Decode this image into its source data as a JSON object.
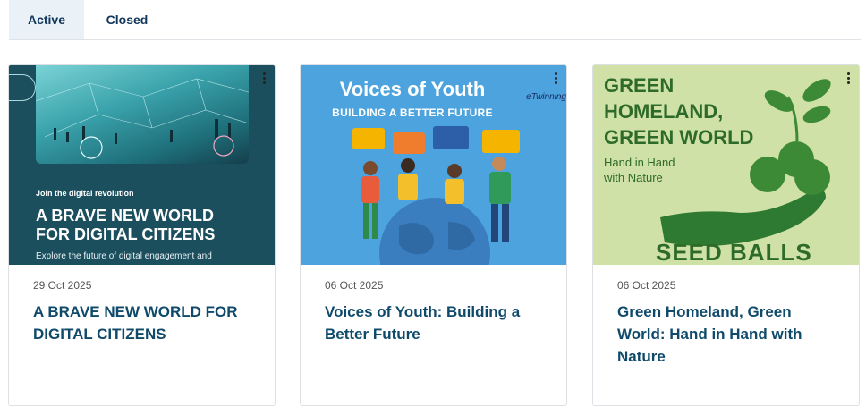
{
  "tabs": [
    {
      "label": "Active"
    },
    {
      "label": "Closed"
    }
  ],
  "cards": [
    {
      "date": "29 Oct 2025",
      "title": "A BRAVE NEW WORLD FOR DIGITAL CITIZENS",
      "image": {
        "kicker": "Join the digital revolution",
        "headline": "A BRAVE NEW WORLD FOR DIGITAL CITIZENS",
        "sub": "Explore the future of digital engagement and"
      }
    },
    {
      "date": "06 Oct 2025",
      "title": "Voices of Youth: Building a Better Future",
      "image": {
        "headline": "Voices of Youth",
        "sub": "BUILDING A BETTER FUTURE",
        "logo": "eTwinning"
      }
    },
    {
      "date": "06 Oct 2025",
      "title": "Green Homeland, Green World: Hand in Hand with Nature",
      "image": {
        "headline": "GREEN HOMELAND, GREEN WORLD",
        "sub": "Hand in Hand with Nature",
        "footer": "SEED BALLS"
      }
    }
  ],
  "colors": {
    "tab_active_bg": "#eaf2f8",
    "tab_text": "#10365a",
    "title_text": "#0f4a6b",
    "card_border": "#dcdfe3"
  }
}
